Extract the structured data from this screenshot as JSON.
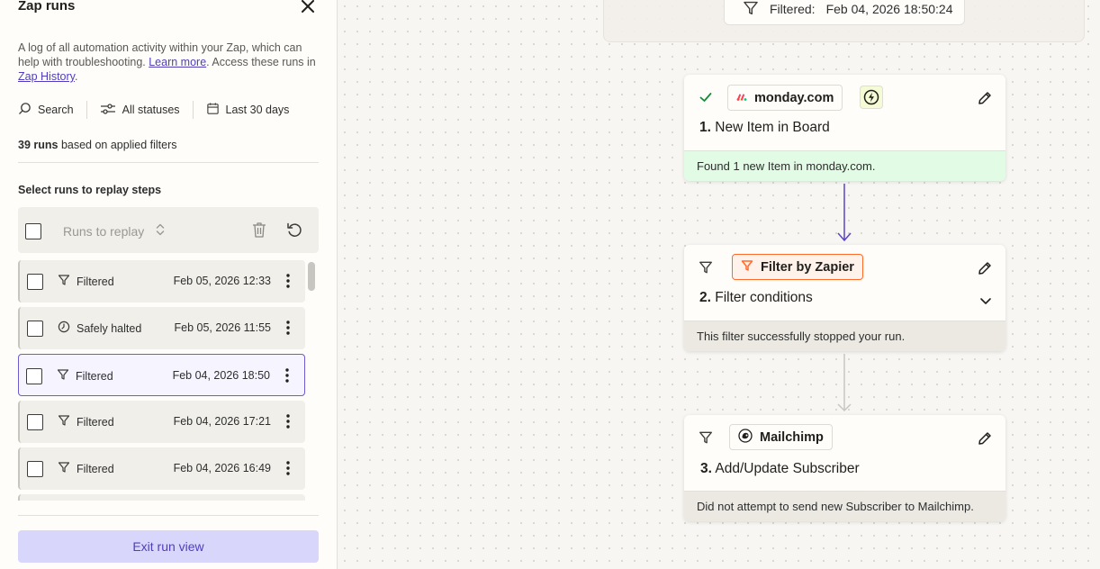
{
  "panel": {
    "title": "Zap runs",
    "description_1": "A log of all automation activity within your Zap, which can help with troubleshooting. ",
    "learn_more": "Learn more",
    "description_2": ". Access these runs in ",
    "zap_history": "Zap History",
    "description_3": ".",
    "search_label": "Search",
    "status_filter": "All statuses",
    "date_filter": "Last 30 days",
    "runs_count": "39 runs",
    "runs_count_suffix": " based on applied filters",
    "select_title": "Select runs to replay steps",
    "replay_label": "Runs to replay",
    "exit_label": "Exit run view",
    "runs": [
      {
        "status": "Filtered",
        "date": "Feb 05, 2026 12:33",
        "icon": "filter-icon"
      },
      {
        "status": "Safely halted",
        "date": "Feb 05, 2026 11:55",
        "icon": "halted-icon"
      },
      {
        "status": "Filtered",
        "date": "Feb 04, 2026 18:50",
        "icon": "filter-icon",
        "selected": true
      },
      {
        "status": "Filtered",
        "date": "Feb 04, 2026 17:21",
        "icon": "filter-icon"
      },
      {
        "status": "Filtered",
        "date": "Feb 04, 2026 16:49",
        "icon": "filter-icon"
      }
    ]
  },
  "canvas": {
    "filtered_label": "Filtered:",
    "filtered_date": "Feb 04, 2026 18:50:24",
    "steps": [
      {
        "app": "monday.com",
        "number": "1.",
        "title": "New Item in Board",
        "message": "Found 1 new Item in monday.com.",
        "status": "success"
      },
      {
        "app": "Filter by Zapier",
        "number": "2.",
        "title": "Filter conditions",
        "message": "This filter successfully stopped your run.",
        "status": "filtered"
      },
      {
        "app": "Mailchimp",
        "number": "3.",
        "title": "Add/Update Subscriber",
        "message": "Did not attempt to send new Subscriber to Mailchimp.",
        "status": "filtered"
      }
    ]
  },
  "colors": {
    "accent": "#503ebd",
    "exit_button_bg": "#d9d6fb",
    "success_bg": "#e2fbe5",
    "filter_orange": "#ff6a2b",
    "connector_purple": "#5a45c8"
  }
}
